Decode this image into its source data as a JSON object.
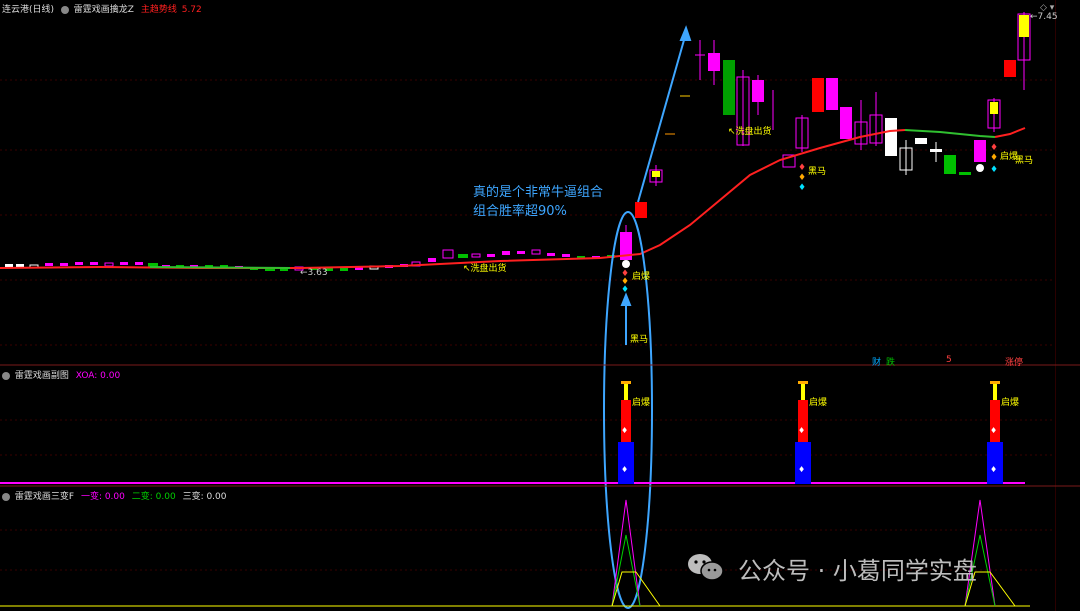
{
  "top_panel": {
    "title": "连云港(日线)",
    "indicator": "雷霆戏画擒龙Z",
    "line_label": "主趋势线",
    "line_value": "5.72",
    "price_high": "7.45",
    "price_low": "3.63",
    "annotation_line1": "真的是个非常牛逼组合",
    "annotation_line2": "组合胜率超90%",
    "labels": {
      "xipan": "洗盘出货",
      "xipan2": "洗盘出货",
      "qibao": "启爆",
      "heima": "黑马",
      "heima2": "黑马",
      "qibao2": "启爆"
    },
    "bottom_tags": [
      "财",
      "跌",
      "5",
      "涨停"
    ]
  },
  "mid_panel": {
    "title": "雷霆戏画副图",
    "sub_label": "XOA: 0.00",
    "qibao": "启爆"
  },
  "bottom_panel": {
    "title": "雷霆戏画三变F",
    "v1_label": "一变: 0.00",
    "v2_label": "二变: 0.00",
    "v3_label": "三变: 0.00"
  },
  "watermark": "公众号 · 小葛同学实盘",
  "colors": {
    "up_candle": "#ff00ff",
    "down_candle": "#00c000",
    "trend_line": "#ff2020",
    "trend_line_green": "#30c030",
    "annotation": "#3ea6ff",
    "red_bar": "#ff0000",
    "blue_bar": "#0000ff",
    "yellow": "#ffff00"
  }
}
